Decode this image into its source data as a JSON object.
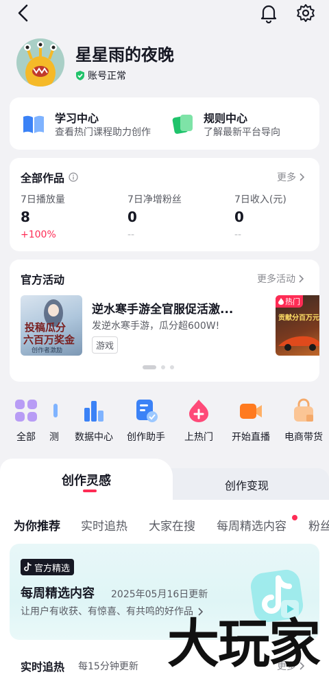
{
  "profile": {
    "username": "星星雨的夜晚",
    "status": "账号正常"
  },
  "centers": [
    {
      "title": "学习中心",
      "subtitle": "查看热门课程助力创作",
      "icon": "book-icon"
    },
    {
      "title": "规则中心",
      "subtitle": "了解最新平台导向",
      "icon": "rules-icon"
    }
  ],
  "works": {
    "title": "全部作品",
    "more": "更多",
    "stats": [
      {
        "label": "7日播放量",
        "value": "8",
        "change": "+100%",
        "change_color": "#fe2c55"
      },
      {
        "label": "7日净增粉丝",
        "value": "0",
        "change": "--",
        "change_color": "#b9babe"
      },
      {
        "label": "7日收入(元)",
        "value": "0",
        "change": "--",
        "change_color": "#b9babe"
      }
    ]
  },
  "activity": {
    "title": "官方活动",
    "more": "更多活动",
    "item": {
      "name": "逆水寒手游全官服促活激...",
      "desc": "发逆水寒手游，瓜分超600W!",
      "tag": "游戏",
      "poster_text_1": "投稿瓜分",
      "poster_text_2": "六百万奖金",
      "poster_text_3": "创作者激励"
    },
    "next_badge": "热门",
    "next_poster_text": "贡献分百万元"
  },
  "tools": [
    {
      "label": "全部",
      "icon": "grid-icon"
    },
    {
      "label": "测",
      "icon": "partial-tool-icon"
    },
    {
      "label": "数据中心",
      "icon": "bar-chart-icon"
    },
    {
      "label": "创作助手",
      "icon": "assistant-icon"
    },
    {
      "label": "上热门",
      "icon": "flame-plus-icon"
    },
    {
      "label": "开始直播",
      "icon": "live-camera-icon"
    },
    {
      "label": "电商带货",
      "icon": "shopping-bag-icon"
    }
  ],
  "inspiration": {
    "tab_active": "创作灵感",
    "tab_other": "创作变现",
    "subtabs": [
      "为你推荐",
      "实时追热",
      "大家在搜",
      "每周精选内容",
      "粉丝"
    ]
  },
  "weekly": {
    "badge": "官方精选",
    "title": "每周精选内容",
    "date": "2025年05月16日更新",
    "desc": "让用户有收获、有惊喜、有共鸣的好作品"
  },
  "realtime": {
    "title": "实时追热",
    "subtitle": "每15分钟更新",
    "more": "更多"
  },
  "watermark": "大玩家",
  "colors": {
    "accent": "#fe2c55",
    "background": "#f2f2f5",
    "teal": "#5fd9dc"
  }
}
